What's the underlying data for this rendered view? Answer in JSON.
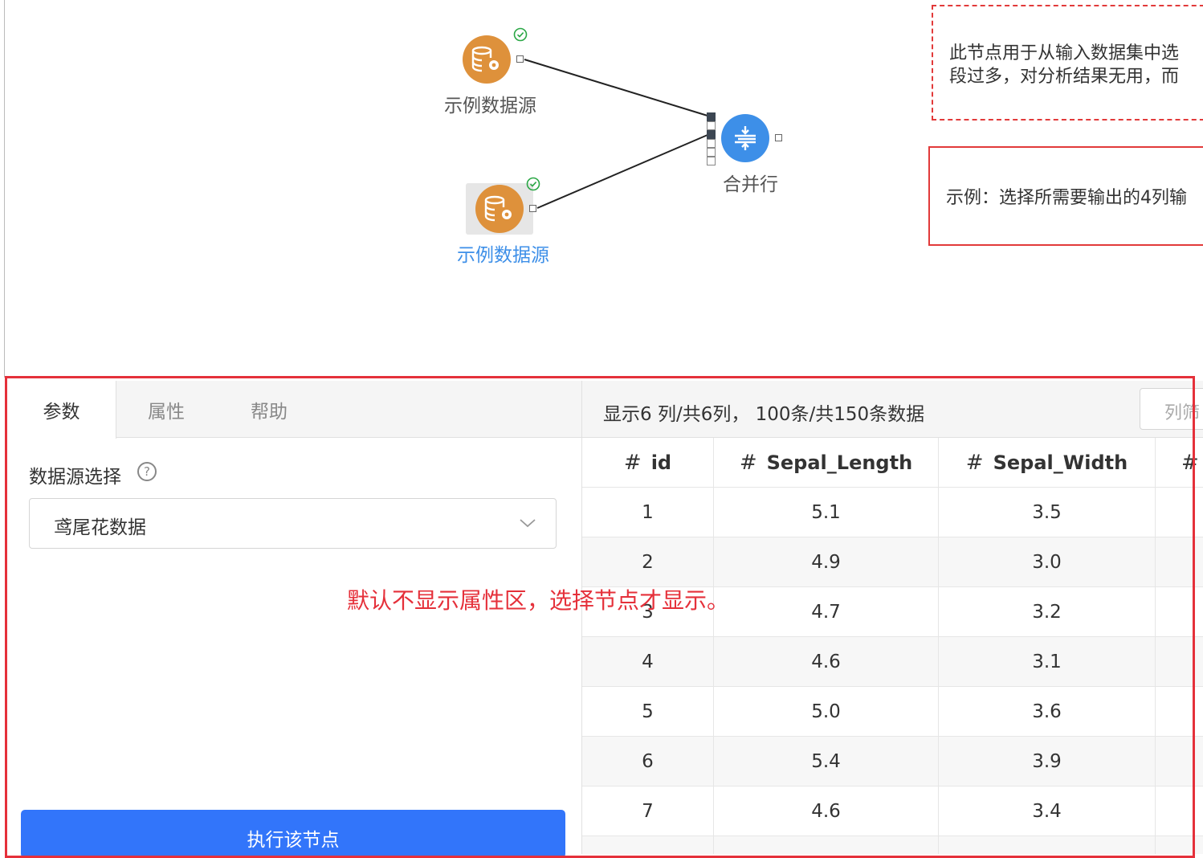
{
  "canvas": {
    "nodes": [
      {
        "label": "示例数据源",
        "icon": "database-gear-icon",
        "status": "success-check-icon"
      },
      {
        "label": "示例数据源",
        "icon": "database-gear-icon",
        "status": "success-check-icon",
        "selected": true
      },
      {
        "label": "合并行",
        "icon": "merge-rows-icon"
      }
    ],
    "notes": {
      "description_line1": "此节点用于从输入数据集中选",
      "description_line2": "段过多，对分析结果无用，而",
      "example": "示例：选择所需要输出的4列输"
    }
  },
  "colors": {
    "node_orange": "#de913b",
    "node_blue": "#3d8fe8",
    "annotation_red": "#e5303a",
    "primary_button": "#3275fa"
  },
  "left_panel": {
    "tabs": [
      {
        "label": "参数",
        "active": true
      },
      {
        "label": "属性",
        "active": false
      },
      {
        "label": "帮助",
        "active": false
      }
    ],
    "datasource_label": "数据源选择",
    "help_icon": "?",
    "datasource_value": "鸢尾花数据",
    "execute_button": "执行该节点"
  },
  "right_panel": {
    "info": "显示6 列/共6列， 100条/共150条数据",
    "filter_button": "列筛",
    "columns": [
      {
        "hash": "#",
        "name": "id"
      },
      {
        "hash": "#",
        "name": "Sepal_Length"
      },
      {
        "hash": "#",
        "name": "Sepal_Width"
      },
      {
        "hash": "#",
        "name": ""
      }
    ],
    "rows": [
      [
        "1",
        "5.1",
        "3.5"
      ],
      [
        "2",
        "4.9",
        "3.0"
      ],
      [
        "3",
        "4.7",
        "3.2"
      ],
      [
        "4",
        "4.6",
        "3.1"
      ],
      [
        "5",
        "5.0",
        "3.6"
      ],
      [
        "6",
        "5.4",
        "3.9"
      ],
      [
        "7",
        "4.6",
        "3.4"
      ]
    ]
  },
  "annotation": "默认不显示属性区，选择节点才显示。"
}
